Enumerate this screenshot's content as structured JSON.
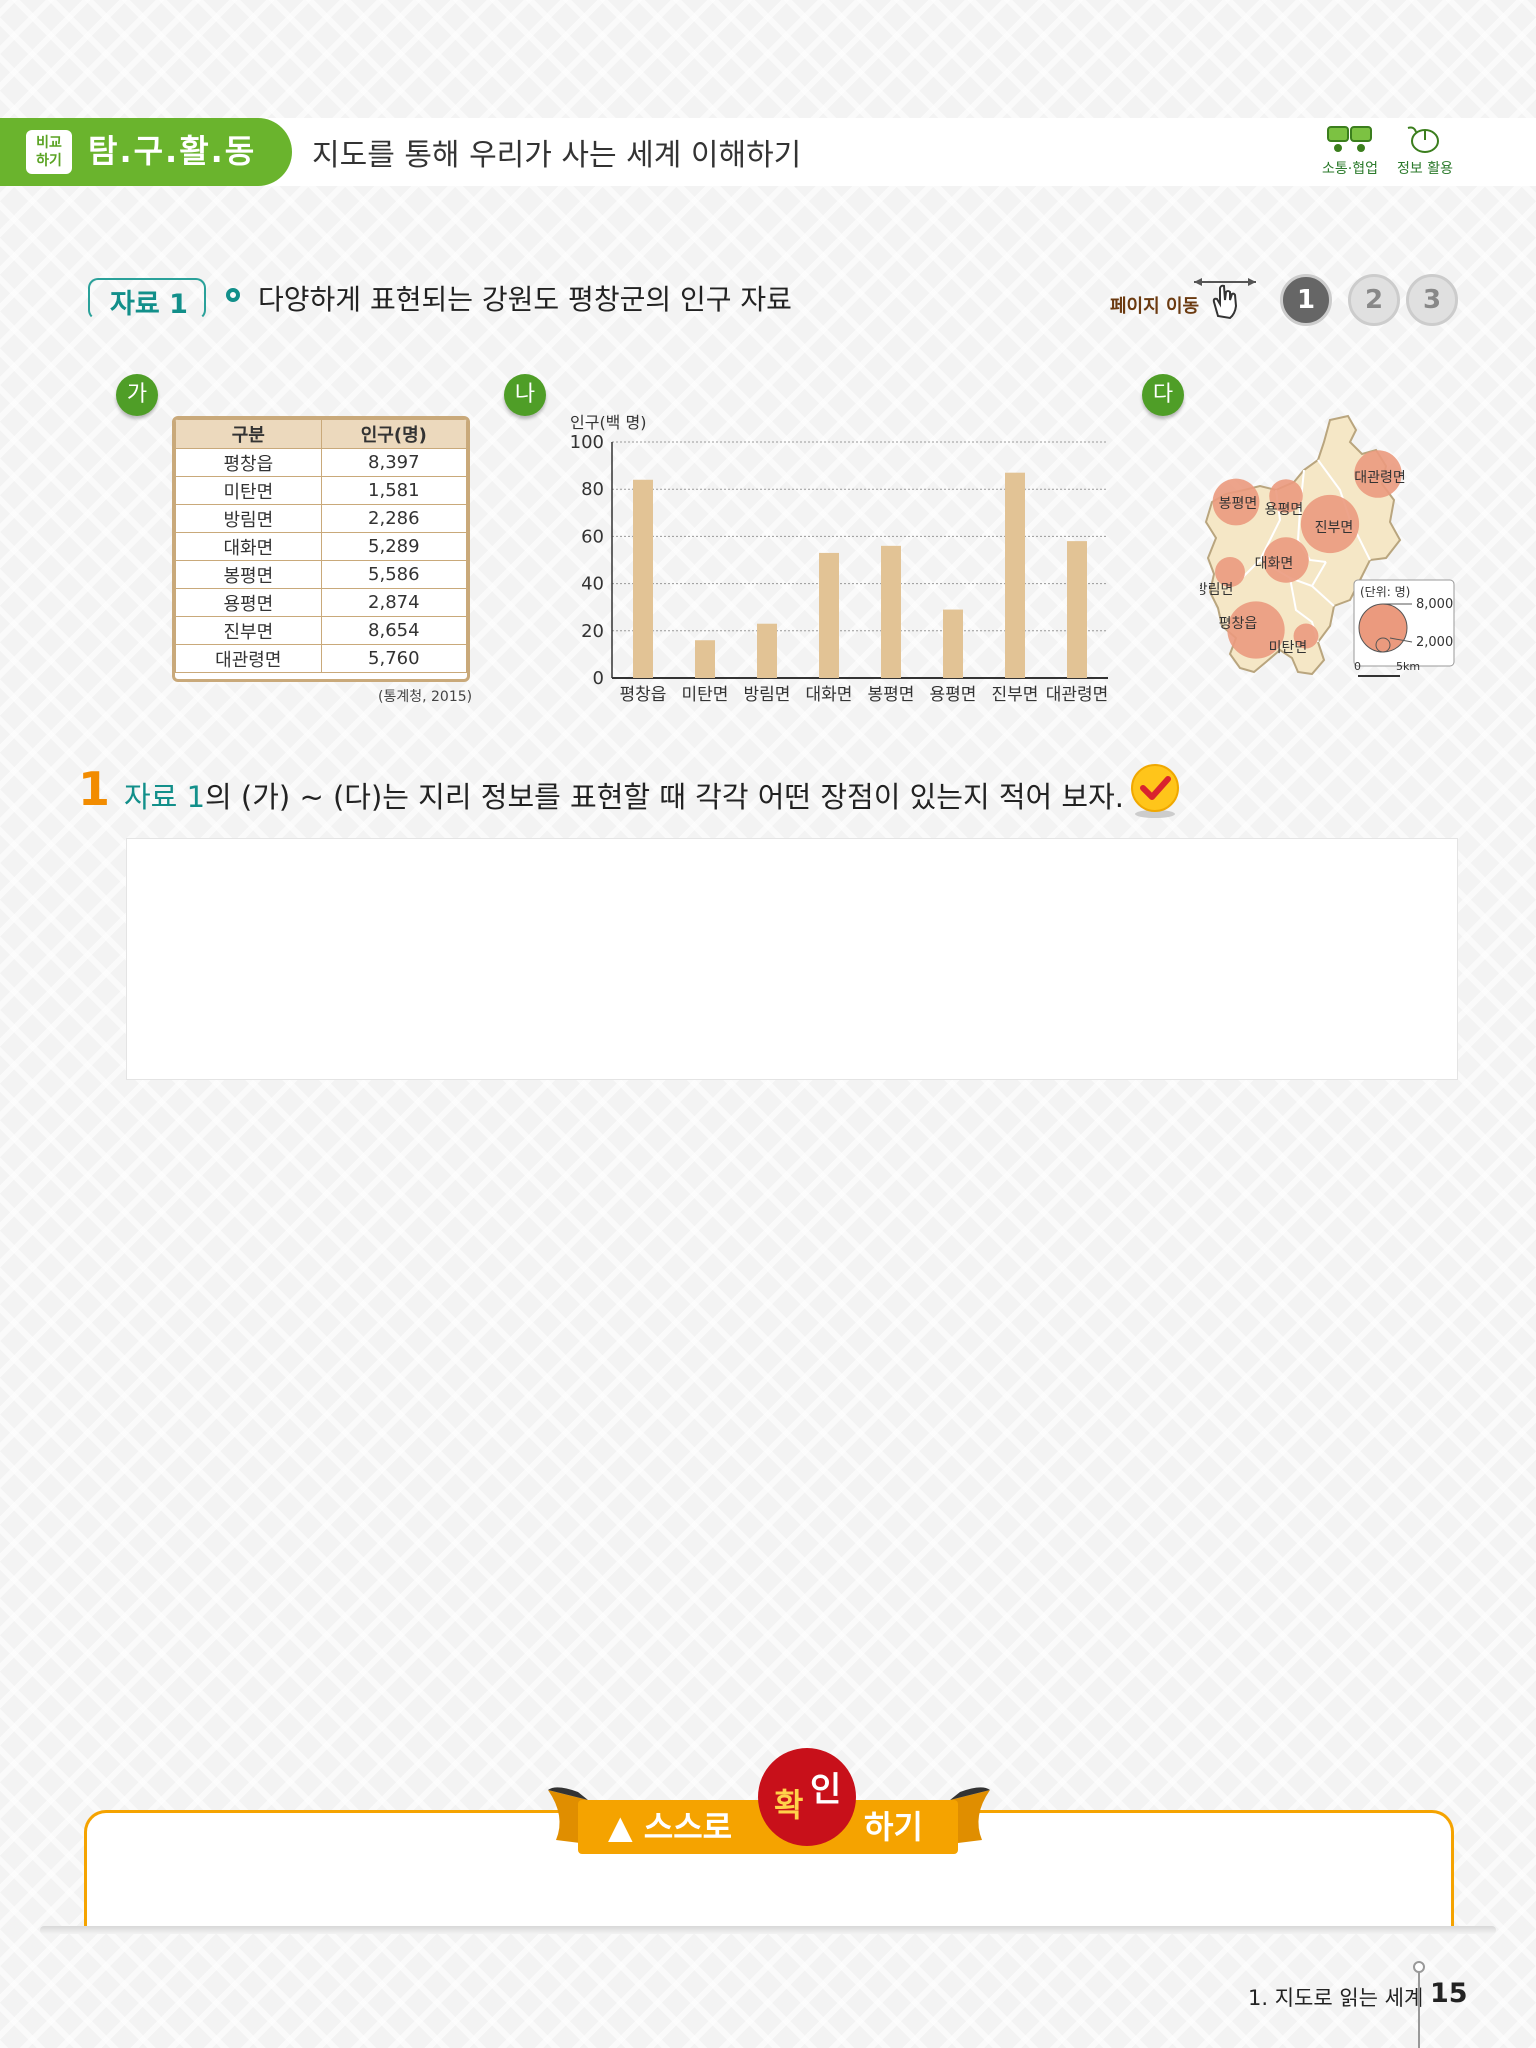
{
  "header": {
    "badge_line1": "비교",
    "badge_line2": "하기",
    "section": "탐.구.활.동",
    "title": "지도를 통해 우리가 사는 세계 이해하기",
    "icon1_label": "소통·협업",
    "icon2_label": "정보 활용"
  },
  "material": {
    "label": "자료 1",
    "title": "다양하게 표현되는 강원도 평창군의 인구 자료",
    "page_nav_label": "페이지 이동",
    "pages": [
      "1",
      "2",
      "3"
    ],
    "current_page": "1"
  },
  "panels": {
    "a": "가",
    "b": "나",
    "c": "다"
  },
  "table": {
    "headers": [
      "구분",
      "인구(명)"
    ],
    "rows": [
      [
        "평창읍",
        "8,397"
      ],
      [
        "미탄면",
        "1,581"
      ],
      [
        "방림면",
        "2,286"
      ],
      [
        "대화면",
        "5,289"
      ],
      [
        "봉평면",
        "5,586"
      ],
      [
        "용평면",
        "2,874"
      ],
      [
        "진부면",
        "8,654"
      ],
      [
        "대관령면",
        "5,760"
      ]
    ],
    "source": "(통계청, 2015)"
  },
  "chart_data": {
    "type": "bar",
    "ylabel": "인구(백 명)",
    "categories": [
      "평창읍",
      "미탄면",
      "방림면",
      "대화면",
      "봉평면",
      "용평면",
      "진부면",
      "대관령면"
    ],
    "values": [
      84,
      16,
      23,
      53,
      56,
      29,
      87,
      58
    ],
    "ylim": [
      0,
      100
    ],
    "yticks": [
      "0",
      "20",
      "40",
      "60",
      "80",
      "100"
    ],
    "grid": true,
    "color": "#e2c395"
  },
  "map": {
    "places": [
      {
        "name": "대관령면",
        "value": 5760
      },
      {
        "name": "봉평면",
        "value": 5586
      },
      {
        "name": "용평면",
        "value": 2874
      },
      {
        "name": "진부면",
        "value": 8654
      },
      {
        "name": "대화면",
        "value": 5289
      },
      {
        "name": "방림면",
        "value": 2286
      },
      {
        "name": "평창읍",
        "value": 8397
      },
      {
        "name": "미탄면",
        "value": 1581
      }
    ],
    "legend_title": "(단위: 명)",
    "legend_large": "8,000",
    "legend_small": "2,000",
    "scale_zero": "0",
    "scale_km": "5km",
    "land_color": "#f5e7c6",
    "circle_color": "#eb9a7e"
  },
  "question": {
    "number": "1",
    "prefix": "자료 1",
    "text": "의 (가) ~ (다)는 지리 정보를 표현할 때 각각 어떤 장점이 있는지 적어  보자."
  },
  "self_check": {
    "prefix": "▲ 스스로",
    "bubble1": "확",
    "bubble2": "인",
    "suffix": "하기"
  },
  "footer": {
    "chapter": "1. 지도로 읽는 세계",
    "page": "15"
  }
}
